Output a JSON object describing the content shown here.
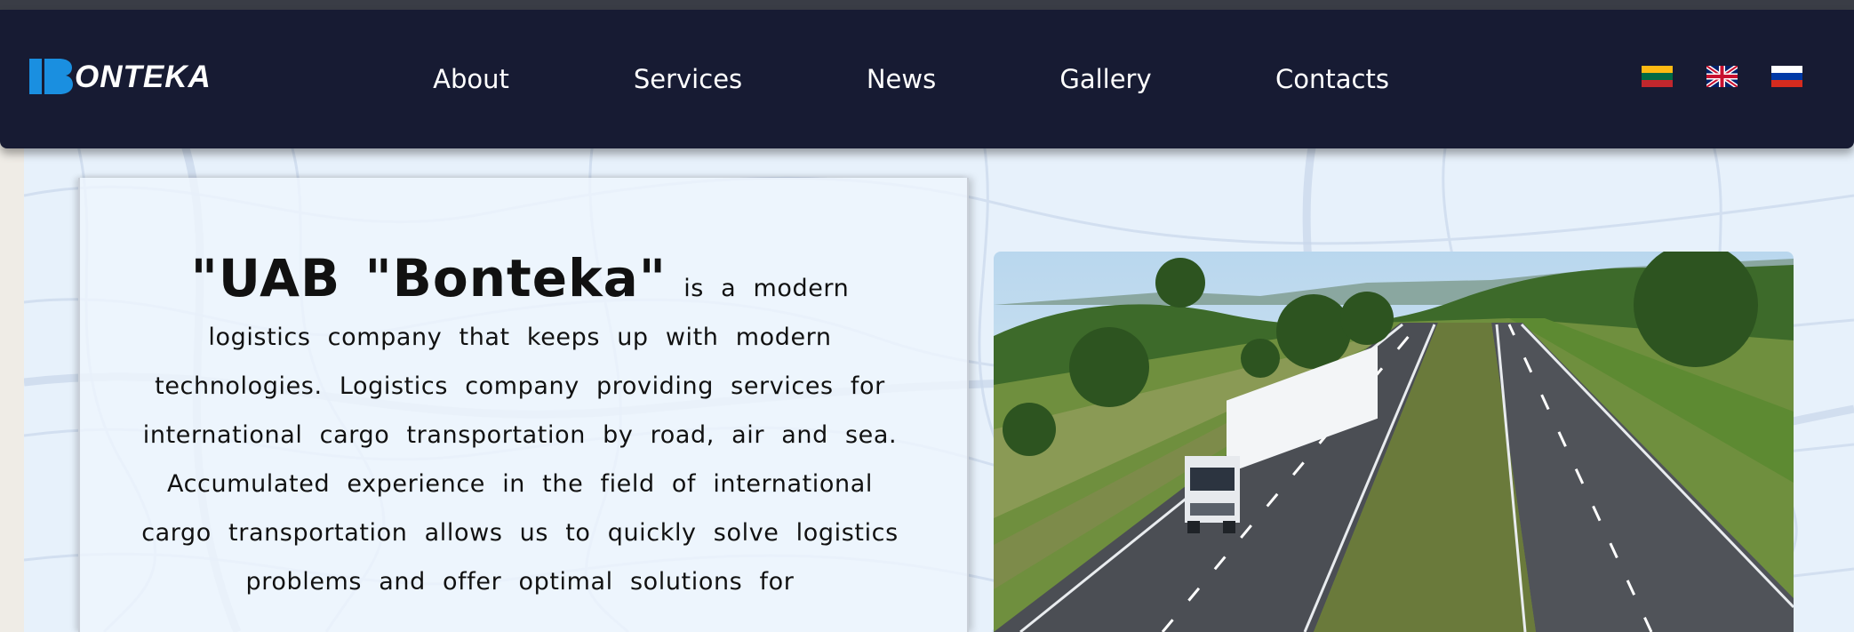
{
  "brand": {
    "name": "ONTEKA",
    "logo_initial": "B"
  },
  "nav": {
    "items": [
      {
        "label": "About"
      },
      {
        "label": "Services"
      },
      {
        "label": "News"
      },
      {
        "label": "Gallery"
      },
      {
        "label": "Contacts"
      }
    ]
  },
  "languages": [
    {
      "icon": "flag-lithuania-icon"
    },
    {
      "icon": "flag-uk-icon"
    },
    {
      "icon": "flag-russia-icon"
    }
  ],
  "about": {
    "company_name": "\"UAB \"Bonteka\"",
    "body": "is a modern logistics company that keeps up with modern technologies. Logistics company providing services for international cargo transportation by road, air and sea. Accumulated experience in the field of international cargo transportation allows us to quickly solve logistics problems and offer optimal solutions for"
  },
  "hero_image": {
    "icon": "truck-highway-photo"
  },
  "colors": {
    "navbar": "#171b33",
    "accent": "#1a8fe0",
    "page_bg": "#e7f1fb",
    "text": "#111111"
  }
}
